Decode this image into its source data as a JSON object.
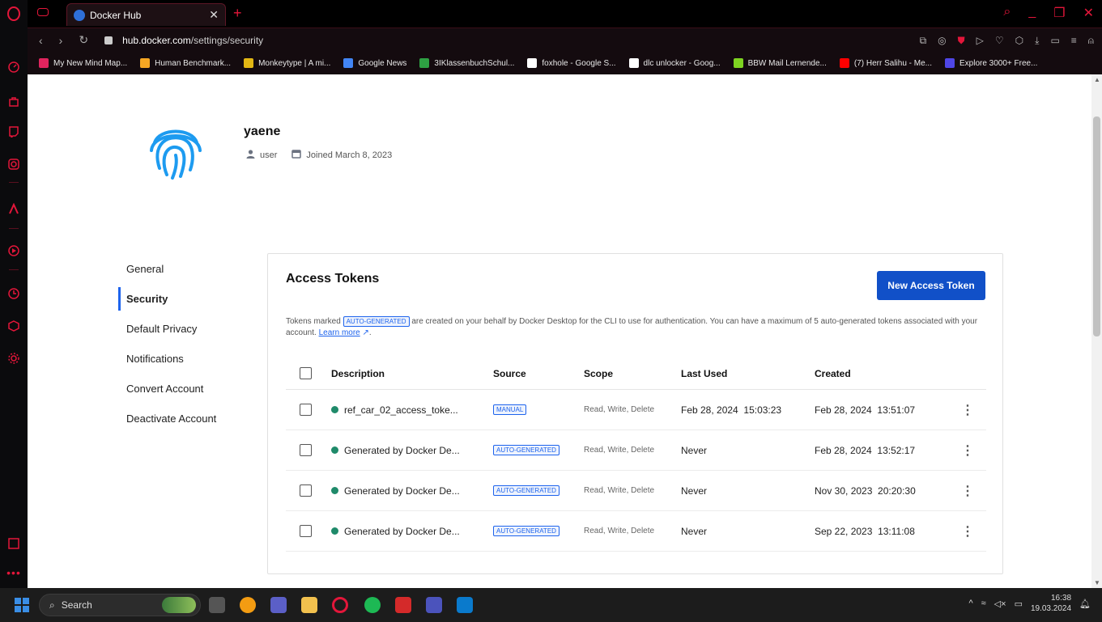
{
  "browser": {
    "tab_title": "Docker Hub",
    "tab_close": "✕",
    "tab_new": "+",
    "url_host": "hub.docker.com",
    "url_path": "/settings/security",
    "bookmarks": [
      {
        "label": "My New Mind Map...",
        "color": "#e0245e"
      },
      {
        "label": "Human Benchmark...",
        "color": "#f5a623"
      },
      {
        "label": "Monkeytype | A mi...",
        "color": "#e2b714"
      },
      {
        "label": "Google News",
        "color": "#4285f4"
      },
      {
        "label": "3IKlassenbuchSchul...",
        "color": "#2ea043"
      },
      {
        "label": "foxhole - Google S...",
        "color": "#ffffff"
      },
      {
        "label": "dlc unlocker - Goog...",
        "color": "#ffffff"
      },
      {
        "label": "BBW Mail Lernende...",
        "color": "#7ed321"
      },
      {
        "label": "(7) Herr Salihu - Me...",
        "color": "#ff0000"
      },
      {
        "label": "Explore 3000+ Free...",
        "color": "#4f46e5"
      }
    ]
  },
  "profile": {
    "username": "yaene",
    "type": "user",
    "joined": "Joined March 8, 2023"
  },
  "settings_nav": [
    {
      "label": "General",
      "active": false
    },
    {
      "label": "Security",
      "active": true
    },
    {
      "label": "Default Privacy",
      "active": false
    },
    {
      "label": "Notifications",
      "active": false
    },
    {
      "label": "Convert Account",
      "active": false
    },
    {
      "label": "Deactivate Account",
      "active": false
    }
  ],
  "tokens": {
    "title": "Access Tokens",
    "new_button": "New Access Token",
    "info_prefix": "Tokens marked",
    "info_badge": "AUTO-GENERATED",
    "info_suffix": "are created on your behalf by Docker Desktop for the CLI to use for authentication. You can have a maximum of 5 auto-generated tokens associated with your account.",
    "learn_more": "Learn more",
    "columns": {
      "description": "Description",
      "source": "Source",
      "scope": "Scope",
      "last_used": "Last Used",
      "created": "Created"
    },
    "rows": [
      {
        "description": "ref_car_02_access_toke...",
        "source": "MANUAL",
        "scope": "Read, Write, Delete",
        "last_used": "Feb 28, 2024  15:03:23",
        "created": "Feb 28, 2024  13:51:07"
      },
      {
        "description": "Generated by Docker De...",
        "source": "AUTO-GENERATED",
        "scope": "Read, Write, Delete",
        "last_used": "Never",
        "created": "Feb 28, 2024  13:52:17"
      },
      {
        "description": "Generated by Docker De...",
        "source": "AUTO-GENERATED",
        "scope": "Read, Write, Delete",
        "last_used": "Never",
        "created": "Nov 30, 2023  20:20:30"
      },
      {
        "description": "Generated by Docker De...",
        "source": "AUTO-GENERATED",
        "scope": "Read, Write, Delete",
        "last_used": "Never",
        "created": "Sep 22, 2023  13:11:08"
      }
    ],
    "status_color": "#1f8a6a",
    "accent": "#1150c8"
  },
  "taskbar": {
    "search": "Search",
    "time": "16:38",
    "date": "19.03.2024"
  }
}
